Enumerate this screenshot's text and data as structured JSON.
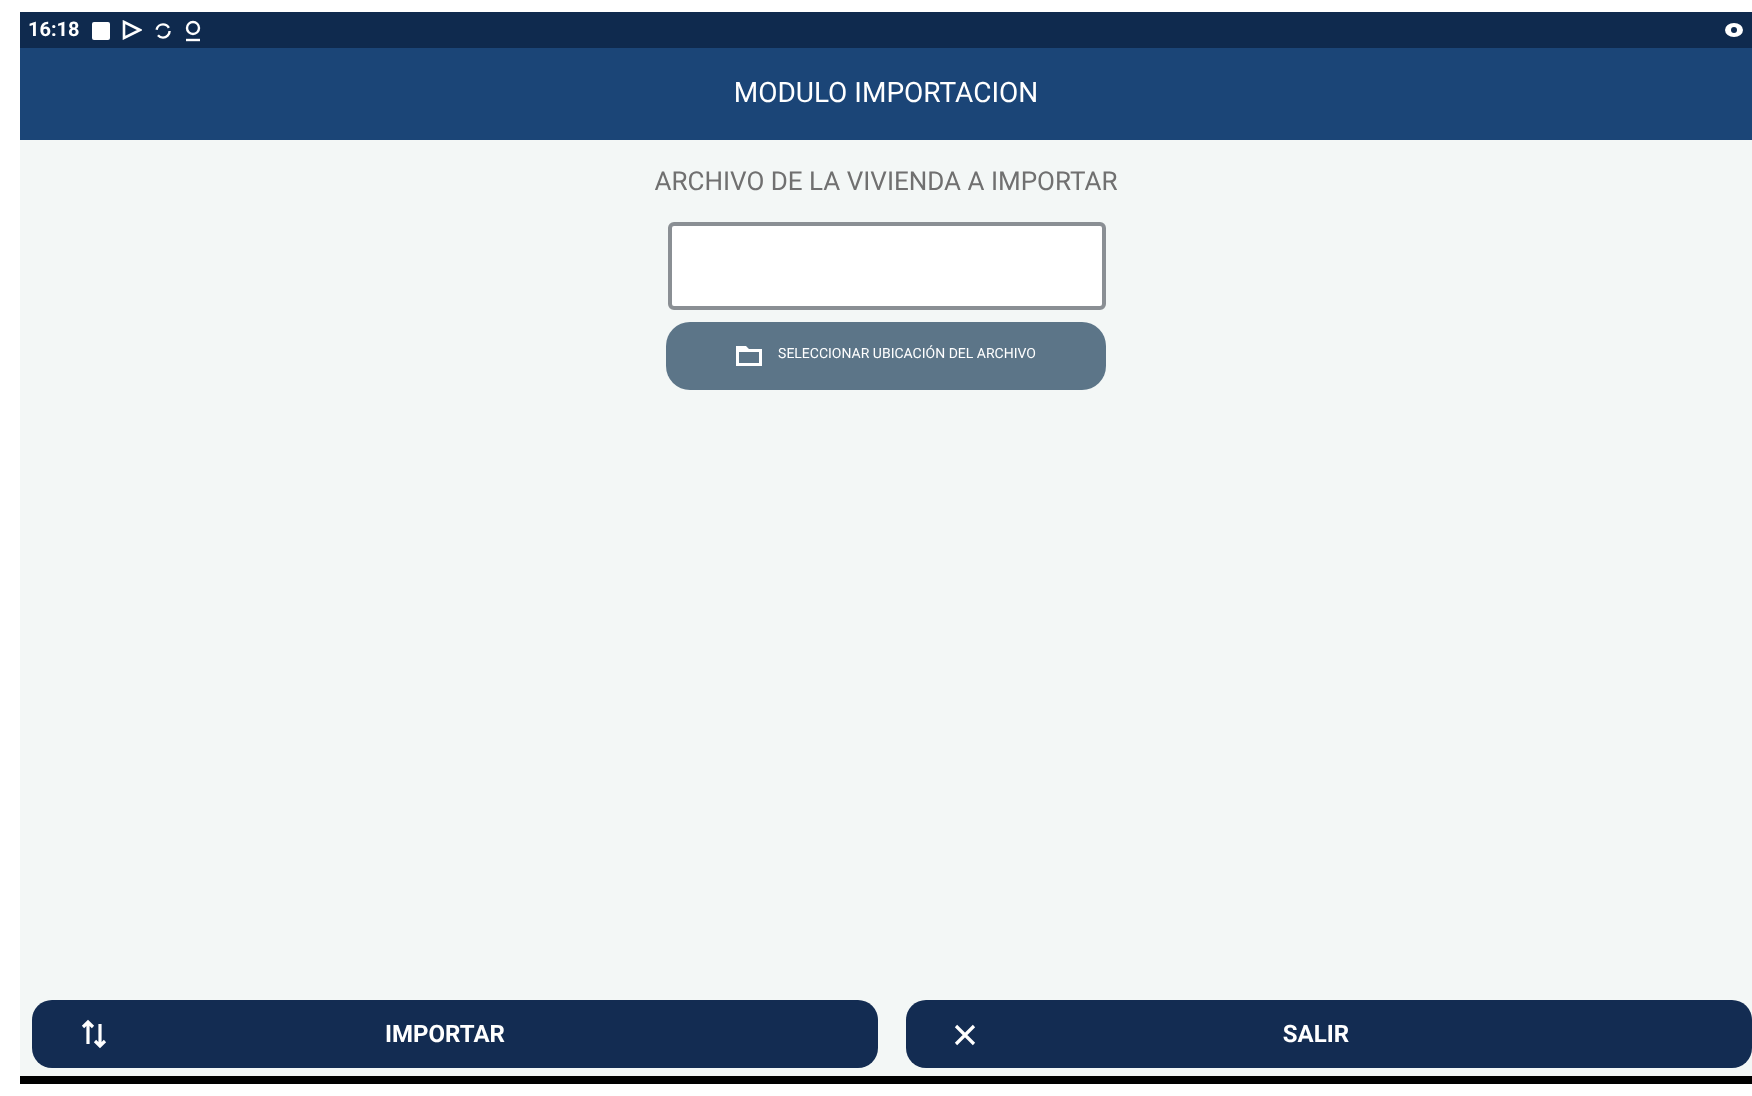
{
  "status_bar": {
    "time": "16:18"
  },
  "header": {
    "title": "MODULO IMPORTACION"
  },
  "file_section": {
    "label": "ARCHIVO DE LA VIVIENDA A IMPORTAR",
    "select_button": "SELECCIONAR UBICACIÓN DEL ARCHIVO"
  },
  "actions": [
    {
      "kind": "import",
      "label": "IMPORTAR"
    },
    {
      "kind": "exit",
      "label": "SALIR"
    }
  ]
}
